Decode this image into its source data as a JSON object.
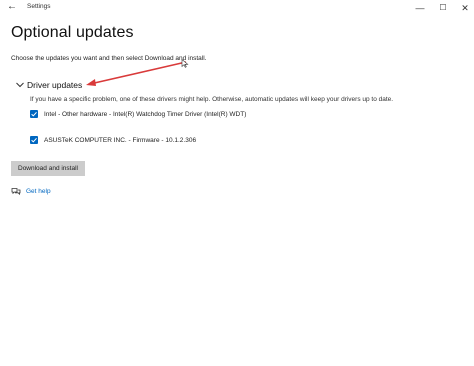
{
  "window": {
    "title": "Settings",
    "controls": {
      "minimize": "—",
      "maximize": "☐",
      "close": "✕"
    },
    "back_icon": "←"
  },
  "page": {
    "title": "Optional updates",
    "intro": "Choose the updates you want and then select Download and install."
  },
  "driver_updates": {
    "label": "Driver updates",
    "hint": "If you have a specific problem, one of these drivers might help. Otherwise, automatic updates will keep your drivers up to date.",
    "items": [
      {
        "label": "Intel - Other hardware - Intel(R) Watchdog Timer Driver (Intel(R) WDT)",
        "checked": true
      },
      {
        "label": "ASUSTeK COMPUTER INC. - Firmware - 10.1.2.306",
        "checked": true
      }
    ]
  },
  "actions": {
    "download_install": "Download and install"
  },
  "help": {
    "label": "Get help"
  },
  "colors": {
    "accent": "#0067c0",
    "annotation_arrow": "#d93a3a",
    "button_bg": "#cccccc"
  }
}
